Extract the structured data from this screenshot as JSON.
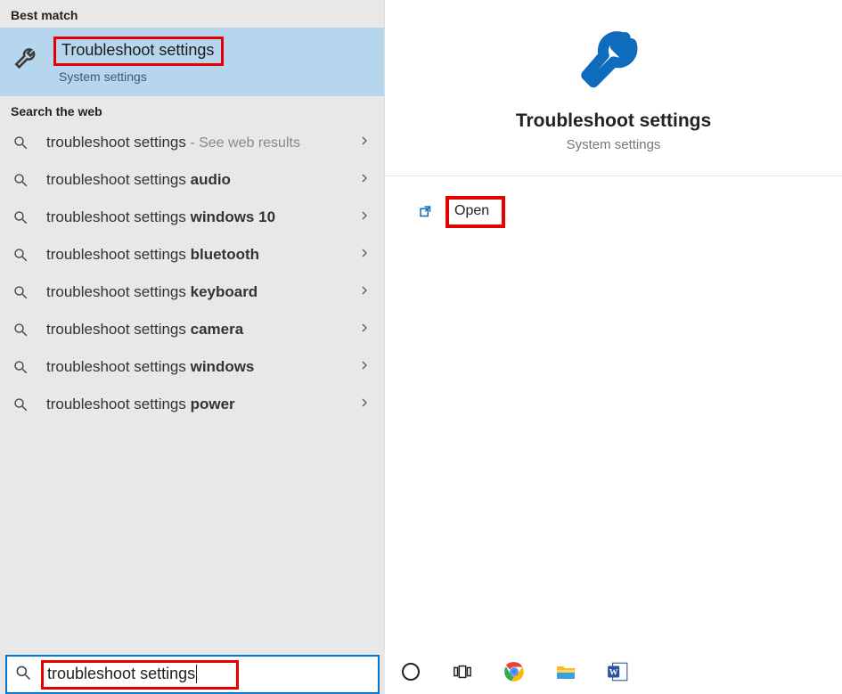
{
  "left": {
    "best_match_header": "Best match",
    "best_match": {
      "title": "Troubleshoot settings",
      "subtitle": "System settings"
    },
    "web_header": "Search the web",
    "web_items": [
      {
        "prefix": "troubleshoot settings",
        "bold": "",
        "suffix": " - See web results",
        "suffix_muted": true
      },
      {
        "prefix": "troubleshoot settings ",
        "bold": "audio"
      },
      {
        "prefix": "troubleshoot settings ",
        "bold": "windows 10"
      },
      {
        "prefix": "troubleshoot settings ",
        "bold": "bluetooth"
      },
      {
        "prefix": "troubleshoot settings ",
        "bold": "keyboard"
      },
      {
        "prefix": "troubleshoot settings ",
        "bold": "camera"
      },
      {
        "prefix": "troubleshoot settings ",
        "bold": "windows"
      },
      {
        "prefix": "troubleshoot settings ",
        "bold": "power"
      }
    ]
  },
  "right": {
    "title": "Troubleshoot settings",
    "subtitle": "System settings",
    "open_label": "Open"
  },
  "search": {
    "query": "troubleshoot settings"
  },
  "taskbar": {
    "items": [
      "cortana-icon",
      "task-view-icon",
      "chrome-icon",
      "file-explorer-icon",
      "word-icon"
    ]
  }
}
